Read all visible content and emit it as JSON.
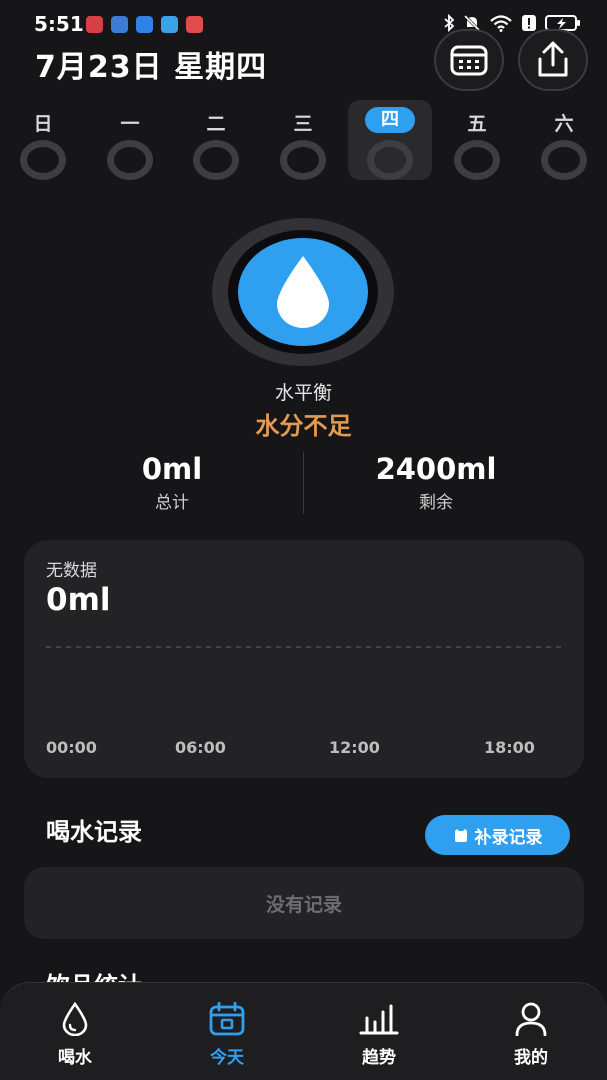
{
  "status_bar": {
    "time": "5:51",
    "battery_label": "!"
  },
  "header": {
    "date": "7月23日 星期四",
    "calendar_button_icon": "calendar-icon",
    "share_button_icon": "share-icon"
  },
  "week": {
    "days": [
      "日",
      "一",
      "二",
      "三",
      "四",
      "五",
      "六"
    ],
    "selected_index": 4
  },
  "hydration": {
    "icon": "water-drop-icon",
    "balance_label": "水平衡",
    "balance_status": "水分不足",
    "total_value": "0ml",
    "total_label": "总计",
    "remaining_value": "2400ml",
    "remaining_label": "剩余"
  },
  "chart_data": {
    "type": "line",
    "title": "",
    "status_text": "无数据",
    "total": "0ml",
    "x_ticks": [
      "00:00",
      "06:00",
      "12:00",
      "18:00"
    ],
    "series": [],
    "goal_line_dashed": true
  },
  "records": {
    "title": "喝水记录",
    "add_button_label": "补录记录",
    "empty_text": "没有记录"
  },
  "next_section": {
    "title": "饮品统计"
  },
  "tabs": [
    {
      "label": "喝水",
      "icon": "water-drop-icon",
      "active": false
    },
    {
      "label": "今天",
      "icon": "calendar-icon",
      "active": true
    },
    {
      "label": "趋势",
      "icon": "bar-chart-icon",
      "active": false
    },
    {
      "label": "我的",
      "icon": "person-icon",
      "active": false
    }
  ],
  "colors": {
    "accent": "#2f9ff0",
    "warning": "#e49a4f",
    "background": "#161618",
    "card": "#232326"
  }
}
